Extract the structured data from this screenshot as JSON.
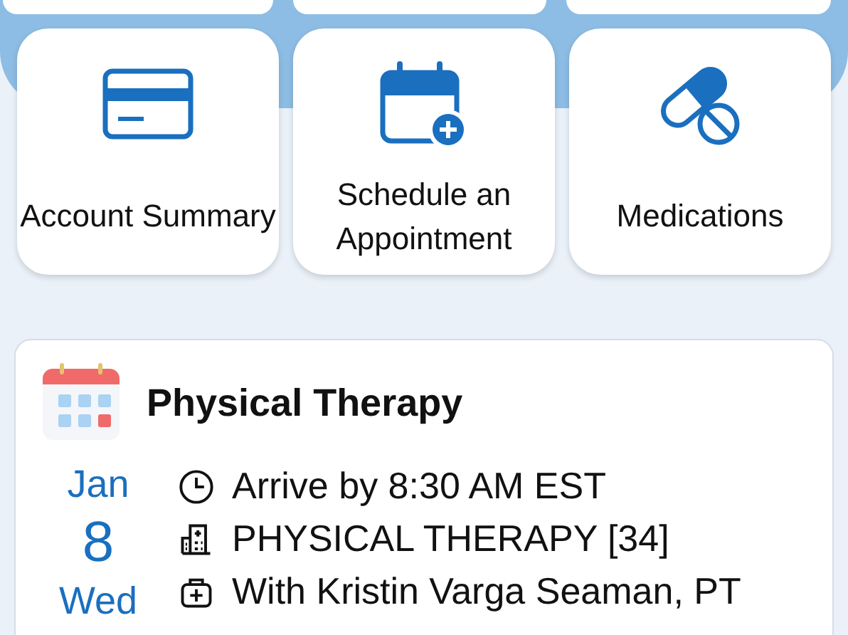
{
  "tiles": [
    {
      "kind": "card",
      "label": "Account Summary"
    },
    {
      "kind": "calendar",
      "label": "Schedule an Appointment"
    },
    {
      "kind": "pills",
      "label": "Medications"
    }
  ],
  "appointment": {
    "title": "Physical Therapy",
    "month": "Jan",
    "day": "8",
    "weekday": "Wed",
    "details": [
      {
        "kind": "clock",
        "text": "Arrive by 8:30 AM EST"
      },
      {
        "kind": "building",
        "text": "PHYSICAL THERAPY [34]"
      },
      {
        "kind": "kit",
        "text": "With Kristin Varga Seaman, PT"
      }
    ]
  }
}
